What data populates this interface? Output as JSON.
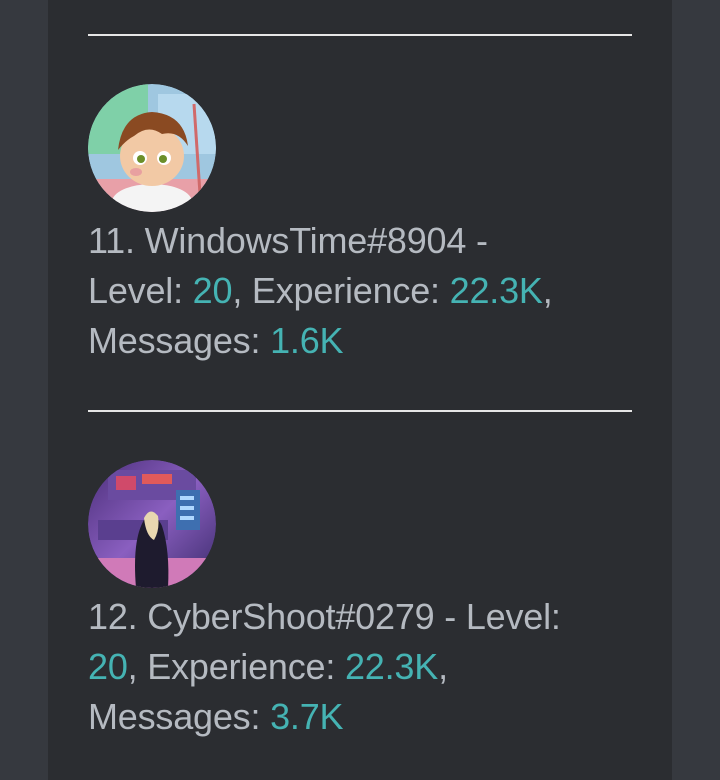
{
  "leaderboard": {
    "entries": [
      {
        "rank_name": "11. WindowsTime#8904 -",
        "level_label": "Level: ",
        "level": "20",
        "experience_label": ", Experience: ",
        "experience": "22.3K",
        "trail_comma": ",",
        "messages_label": "Messages: ",
        "messages": "1.6K"
      },
      {
        "rank_name_level_label": "12. CyberShoot#0279 - Level:",
        "level": "20",
        "experience_label": ", Experience: ",
        "experience": "22.3K",
        "trail_comma": ",",
        "messages_label": "Messages: ",
        "messages": "3.7K"
      }
    ]
  },
  "colors": {
    "background": "#36393f",
    "panel": "#2b2d31",
    "text": "#b5bac1",
    "value": "#45b3b3",
    "divider": "#e6e6e6"
  }
}
